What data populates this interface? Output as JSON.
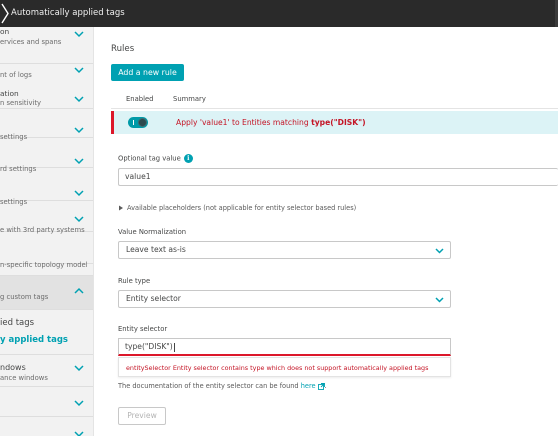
{
  "topbar": {
    "title": "Automatically applied tags"
  },
  "sidebar": {
    "items": [
      {
        "t1": "on",
        "t2": "ervices and spans"
      },
      {
        "t1": "",
        "t2": "nt of logs"
      },
      {
        "t1": "ation",
        "t2": "n sensitivity"
      },
      {
        "t1": "",
        "t2": "settings"
      },
      {
        "t1": "",
        "t2": "rd settings"
      },
      {
        "t1": "",
        "t2": "settings"
      },
      {
        "t1": "",
        "t2": "e with 3rd party systems"
      },
      {
        "t1": "",
        "t2": "n-specific topology model"
      },
      {
        "t1": "",
        "t2": "g custom tags"
      },
      {
        "t1": "ndows",
        "t2": "ance windows"
      }
    ],
    "sub_items": [
      {
        "label": "ied tags"
      },
      {
        "label": "y applied tags"
      }
    ]
  },
  "main": {
    "rules_title": "Rules",
    "add_rule_label": "Add a new rule",
    "col_enabled": "Enabled",
    "col_summary": "Summary",
    "rule": {
      "enabled": true,
      "summary_prefix": "Apply 'value1' to Entities matching ",
      "summary_bold": "type(\"DISK\")"
    },
    "optional_tag_label": "Optional tag value",
    "optional_tag_value": "value1",
    "placeholders_expander": "Available placeholders (not applicable for entity selector based rules)",
    "value_normalization_label": "Value Normalization",
    "value_normalization_value": "Leave text as-is",
    "rule_type_label": "Rule type",
    "rule_type_value": "Entity selector",
    "entity_selector_label": "Entity selector",
    "entity_selector_value": "type(\"DISK\")",
    "error_message": "entitySelector Entity selector contains type which does not support automatically applied tags",
    "doc_note_prefix": "The documentation of the entity selector can be found ",
    "doc_link": "here",
    "doc_note_suffix": ".",
    "preview_label": "Preview"
  },
  "colors": {
    "accent": "#00a1b2",
    "error": "#dc172a",
    "rule_row_bg": "#dcf3f6",
    "topbar_bg": "#2a2a2a"
  }
}
